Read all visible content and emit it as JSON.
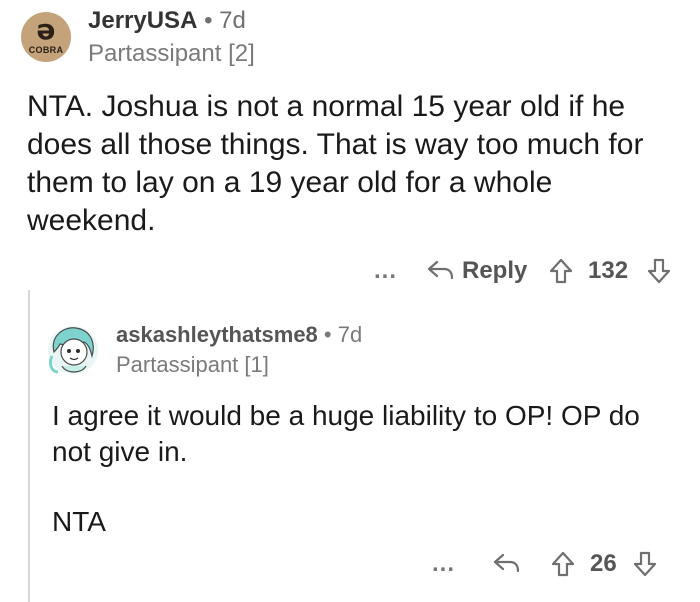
{
  "comment": {
    "avatar_glyph": "ə",
    "avatar_word": "COBRA",
    "avatar_color": "#c4a37b",
    "username": "JerryUSA",
    "separator": "•",
    "age": "7d",
    "flair": "Partassipant [2]",
    "body": "NTA. Joshua is not a normal 15 year old if he does all those things. That is way too much for them to lay on a 19 year old for a whole weekend.",
    "actions": {
      "more": "...",
      "reply_label": "Reply",
      "score": "132"
    }
  },
  "reply": {
    "username": "askashleythatsme8",
    "separator": "•",
    "age": "7d",
    "flair": "Partassipant [1]",
    "body_lines": [
      "I agree it would be a huge liability to OP! OP do not give in.",
      "NTA"
    ],
    "actions": {
      "more": "...",
      "score": "26"
    }
  }
}
